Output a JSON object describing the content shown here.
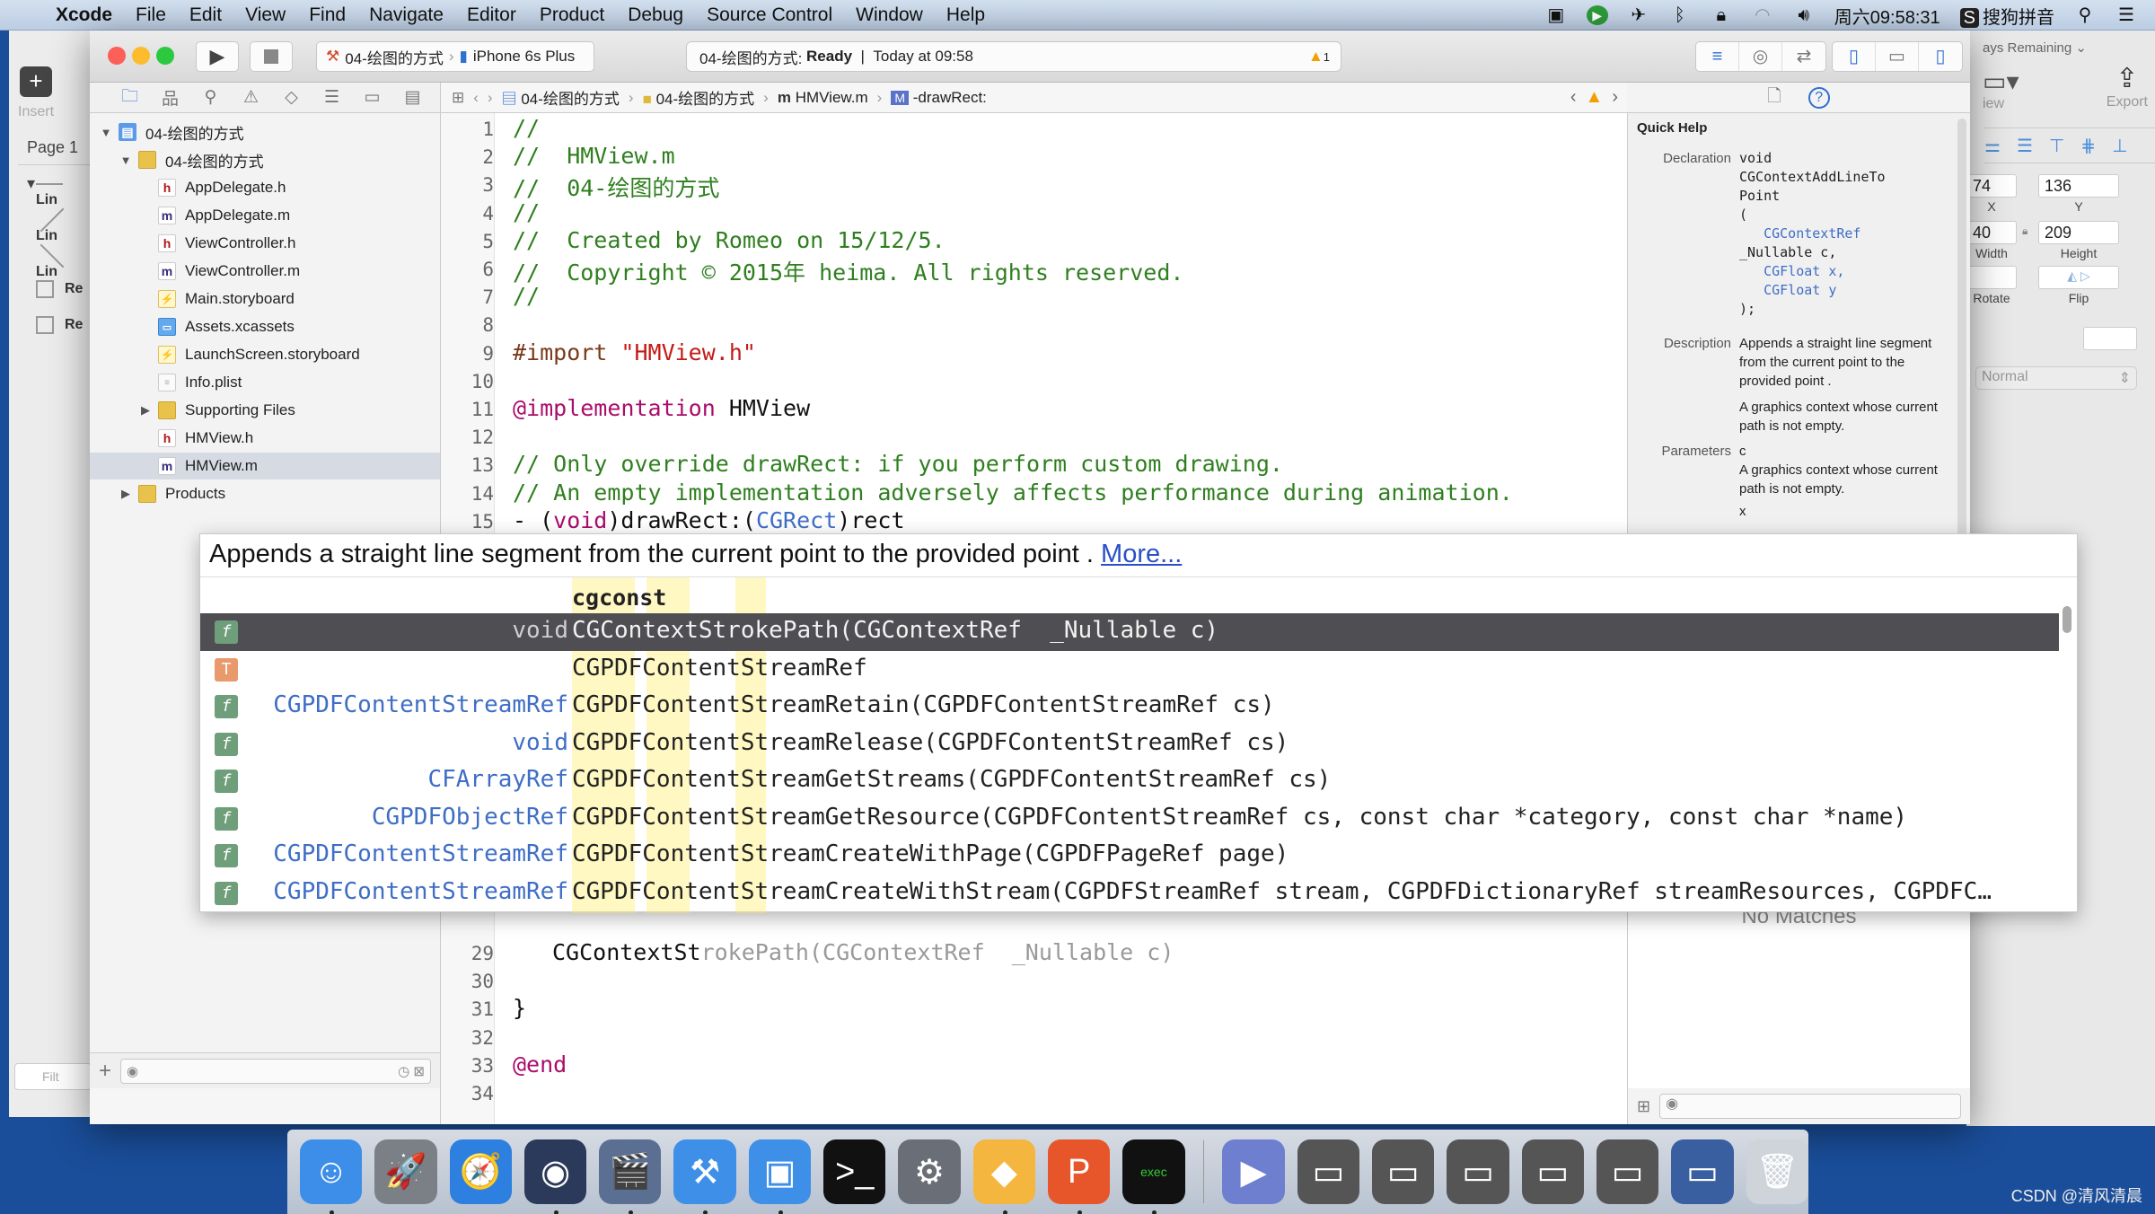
{
  "menubar": {
    "app": "Xcode",
    "items": [
      "File",
      "Edit",
      "View",
      "Find",
      "Navigate",
      "Editor",
      "Product",
      "Debug",
      "Source Control",
      "Window",
      "Help"
    ],
    "clock": "周六09:58:31",
    "input_method": "搜狗拼音"
  },
  "sketch": {
    "insert_label": "Insert",
    "page_label": "Page 1",
    "layers": [
      "Lin",
      "Lin",
      "Lin",
      "Re",
      "Re"
    ],
    "filter_placeholder": "Filt",
    "days_remaining": "ays Remaining",
    "view_label": "iew",
    "export_label": "Export",
    "x_value": "74",
    "y_value": "136",
    "width_value": "40",
    "height_value": "209",
    "x_label": "X",
    "y_label": "Y",
    "width_label": "Width",
    "height_label": "Height",
    "rotate_label": "Rotate",
    "flip_label": "Flip",
    "blend_mode": "Normal"
  },
  "toolbar": {
    "scheme": "04-绘图的方式",
    "device": "iPhone 6s Plus",
    "activity_project": "04-绘图的方式:",
    "activity_status": "Ready",
    "activity_time": "Today at 09:58",
    "warning_count": "1"
  },
  "jumpbar": {
    "crumbs": [
      "04-绘图的方式",
      "04-绘图的方式",
      "HMView.m",
      "-drawRect:"
    ]
  },
  "navigator": {
    "tree": [
      {
        "label": "04-绘图的方式",
        "type": "project",
        "depth": 0,
        "expanded": true
      },
      {
        "label": "04-绘图的方式",
        "type": "folder",
        "depth": 1,
        "expanded": true
      },
      {
        "label": "AppDelegate.h",
        "type": "h",
        "depth": 2
      },
      {
        "label": "AppDelegate.m",
        "type": "m",
        "depth": 2
      },
      {
        "label": "ViewController.h",
        "type": "h",
        "depth": 2
      },
      {
        "label": "ViewController.m",
        "type": "m",
        "depth": 2
      },
      {
        "label": "Main.storyboard",
        "type": "storyboard",
        "depth": 2
      },
      {
        "label": "Assets.xcassets",
        "type": "xcassets",
        "depth": 2
      },
      {
        "label": "LaunchScreen.storyboard",
        "type": "storyboard",
        "depth": 2
      },
      {
        "label": "Info.plist",
        "type": "plist",
        "depth": 2
      },
      {
        "label": "Supporting Files",
        "type": "folder",
        "depth": 2,
        "expanded": false
      },
      {
        "label": "HMView.h",
        "type": "h",
        "depth": 2
      },
      {
        "label": "HMView.m",
        "type": "m",
        "depth": 2,
        "selected": true
      },
      {
        "label": "Products",
        "type": "folder",
        "depth": 1,
        "expanded": false
      }
    ]
  },
  "editor": {
    "lines": [
      {
        "n": "1",
        "text": "//",
        "cls": "c-com"
      },
      {
        "n": "2",
        "text": "//  HMView.m",
        "cls": "c-com"
      },
      {
        "n": "3",
        "text": "//  04-绘图的方式",
        "cls": "c-com"
      },
      {
        "n": "4",
        "text": "//",
        "cls": "c-com"
      },
      {
        "n": "5",
        "text": "//  Created by Romeo on 15/12/5.",
        "cls": "c-com"
      },
      {
        "n": "6",
        "text": "//  Copyright © 2015年 heima. All rights reserved.",
        "cls": "c-com"
      },
      {
        "n": "7",
        "text": "//",
        "cls": "c-com"
      },
      {
        "n": "8",
        "text": "",
        "cls": ""
      },
      {
        "n": "9",
        "text": "#import \"HMView.h\"",
        "cls": "import"
      },
      {
        "n": "10",
        "text": "",
        "cls": ""
      },
      {
        "n": "11",
        "text": "@implementation HMView",
        "cls": "impl"
      },
      {
        "n": "12",
        "text": "",
        "cls": ""
      },
      {
        "n": "13",
        "text": "// Only override drawRect: if you perform custom drawing.",
        "cls": "c-com"
      },
      {
        "n": "14",
        "text": "// An empty implementation adversely affects performance during animation.",
        "cls": "c-com"
      },
      {
        "n": "15",
        "text": "- (void)drawRect:(CGRect)rect",
        "cls": "partial"
      }
    ],
    "lines_bottom": [
      {
        "n": "29",
        "typed": "CGContextSt",
        "ghost": "rokePath(CGContextRef  _Nullable c)"
      },
      {
        "n": "30",
        "text": ""
      },
      {
        "n": "31",
        "text": "}"
      },
      {
        "n": "32",
        "text": ""
      },
      {
        "n": "33",
        "text": "@end"
      },
      {
        "n": "34",
        "text": ""
      }
    ]
  },
  "quick_help": {
    "title": "Quick Help",
    "declaration_label": "Declaration",
    "declaration": [
      "void",
      "CGContextAddLineTo",
      "Point",
      "(",
      "   CGContextRef",
      "_Nullable c,",
      "   CGFloat x,",
      "   CGFloat y",
      ");"
    ],
    "description_label": "Description",
    "description": "Appends a straight line segment from the current point to the provided point .",
    "description_extra": "A graphics context whose current path is not empty.",
    "parameters_label": "Parameters",
    "param_name": "c",
    "param_desc": "A graphics context whose current path is not empty.",
    "param_next": "x"
  },
  "library": {
    "no_matches": "No Matches"
  },
  "completion": {
    "description": "Appends a straight line segment from the current point to the provided point .",
    "more_link": "More...",
    "typed": "cgconst",
    "items": [
      {
        "kind": "f",
        "ret": "void",
        "sig": "CGContextStrokePath(CGContextRef  _Nullable c)",
        "selected": true
      },
      {
        "kind": "T",
        "ret": "",
        "sig": "CGPDFContentStreamRef"
      },
      {
        "kind": "f",
        "ret": "CGPDFContentStreamRef",
        "sig": "CGPDFContentStreamRetain(CGPDFContentStreamRef cs)"
      },
      {
        "kind": "f",
        "ret": "void",
        "sig": "CGPDFContentStreamRelease(CGPDFContentStreamRef cs)"
      },
      {
        "kind": "f",
        "ret": "CFArrayRef",
        "sig": "CGPDFContentStreamGetStreams(CGPDFContentStreamRef cs)"
      },
      {
        "kind": "f",
        "ret": "CGPDFObjectRef",
        "sig": "CGPDFContentStreamGetResource(CGPDFContentStreamRef cs, const char *category, const char *name)"
      },
      {
        "kind": "f",
        "ret": "CGPDFContentStreamRef",
        "sig": "CGPDFContentStreamCreateWithPage(CGPDFPageRef page)"
      },
      {
        "kind": "f",
        "ret": "CGPDFContentStreamRef",
        "sig": "CGPDFContentStreamCreateWithStream(CGPDFStreamRef stream, CGPDFDictionaryRef streamResources, CGPDFC…"
      }
    ]
  },
  "dock": {
    "apps": [
      {
        "name": "finder",
        "glyph": "☺",
        "bg": "#3d8ee8",
        "running": true
      },
      {
        "name": "launchpad",
        "glyph": "🚀",
        "bg": "#7b7f86",
        "running": false
      },
      {
        "name": "safari",
        "glyph": "🧭",
        "bg": "#2d7fe0",
        "running": false
      },
      {
        "name": "mouse-app",
        "glyph": "◉",
        "bg": "#2b3a5a",
        "running": true
      },
      {
        "name": "video-app",
        "glyph": "🎬",
        "bg": "#5a6f92",
        "running": true
      },
      {
        "name": "xcode",
        "glyph": "⚒",
        "bg": "#3d8fe8",
        "running": true
      },
      {
        "name": "simulator",
        "glyph": "▣",
        "bg": "#3d8fe8",
        "running": true
      },
      {
        "name": "terminal",
        "glyph": ">_",
        "bg": "#111",
        "running": false
      },
      {
        "name": "system-preferences",
        "glyph": "⚙",
        "bg": "#6a6e76",
        "running": false
      },
      {
        "name": "sketch",
        "glyph": "◆",
        "bg": "#f4b63e",
        "running": true
      },
      {
        "name": "keynote-p",
        "glyph": "P",
        "bg": "#e7562a",
        "running": true
      },
      {
        "name": "console",
        "glyph": "exec",
        "bg": "#111",
        "running": true
      },
      {
        "name": "media-player",
        "glyph": "▶",
        "bg": "#6f7fd0",
        "running": false
      },
      {
        "name": "window-1",
        "glyph": "▭",
        "bg": "#555",
        "running": false
      },
      {
        "name": "window-2",
        "glyph": "▭",
        "bg": "#555",
        "running": false
      },
      {
        "name": "window-3",
        "glyph": "▭",
        "bg": "#555",
        "running": false
      },
      {
        "name": "window-4",
        "glyph": "▭",
        "bg": "#555",
        "running": false
      },
      {
        "name": "window-5",
        "glyph": "▭",
        "bg": "#555",
        "running": false
      },
      {
        "name": "window-6",
        "glyph": "▭",
        "bg": "#3a5fa0",
        "running": false
      },
      {
        "name": "trash",
        "glyph": "🗑",
        "bg": "#cfd4da",
        "running": false
      }
    ]
  },
  "watermark": "CSDN @清风清晨"
}
